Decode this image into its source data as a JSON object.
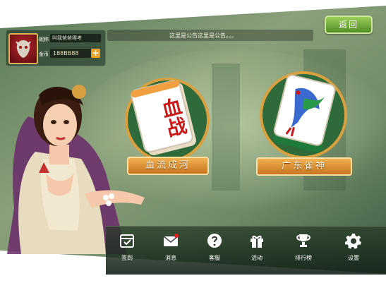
{
  "player": {
    "name_label": "昵称",
    "name_value": "叫我爸爸得考",
    "coins_label": "金币",
    "coins_value": "188BB88",
    "add_coins": "+"
  },
  "notice": {
    "text": "这里是公告这里是公告。。。"
  },
  "back_button": "返回",
  "games": [
    {
      "title": "血流成河",
      "tile_text": "血战"
    },
    {
      "title": "广东雀神"
    }
  ],
  "nav": [
    {
      "label": "签到",
      "icon": "calendar-check-icon"
    },
    {
      "label": "消息",
      "icon": "mail-icon"
    },
    {
      "label": "客服",
      "icon": "help-icon"
    },
    {
      "label": "活动",
      "icon": "gift-icon"
    },
    {
      "label": "排行榜",
      "icon": "trophy-icon"
    },
    {
      "label": "设置",
      "icon": "gear-icon"
    }
  ],
  "colors": {
    "accent_gold": "#d9a040",
    "back_green": "#6fae36",
    "nav_bar": "#1e3324"
  }
}
